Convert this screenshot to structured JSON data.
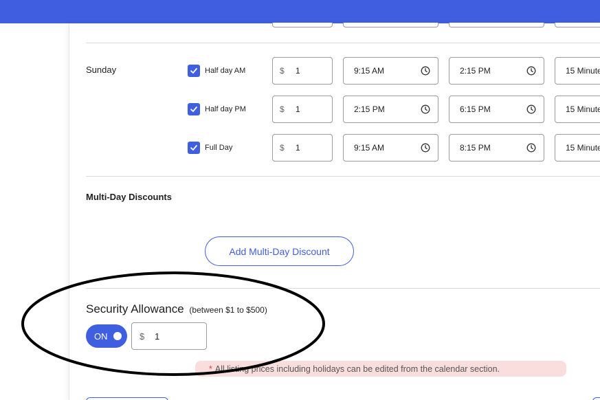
{
  "colors": {
    "accent": "#3f5ee0",
    "notice_bg": "#fadede",
    "asterisk": "#e23b3b"
  },
  "sunday": {
    "day_label": "Sunday",
    "rows": [
      {
        "checked": true,
        "label": "Half day AM",
        "currency": "$",
        "price": "1",
        "start": "9:15 AM",
        "end": "2:15 PM",
        "interval": "15 Minute"
      },
      {
        "checked": true,
        "label": "Half day PM",
        "currency": "$",
        "price": "1",
        "start": "2:15 PM",
        "end": "6:15 PM",
        "interval": "15 Minute"
      },
      {
        "checked": true,
        "label": "Full Day",
        "currency": "$",
        "price": "1",
        "start": "9:15 AM",
        "end": "8:15 PM",
        "interval": "15 Minute"
      }
    ]
  },
  "multi_day": {
    "title": "Multi-Day Discounts",
    "add_button": "Add Multi-Day Discount"
  },
  "security": {
    "title": "Security Allowance",
    "subtitle": "(between $1 to $500)",
    "toggle_label": "ON",
    "currency": "$",
    "value": "1"
  },
  "notice": {
    "asterisk": "*",
    "text": "All listing prices including holidays can be edited from the calendar section."
  },
  "icons": {
    "checkbox": "check-icon",
    "clock": "clock-icon"
  }
}
